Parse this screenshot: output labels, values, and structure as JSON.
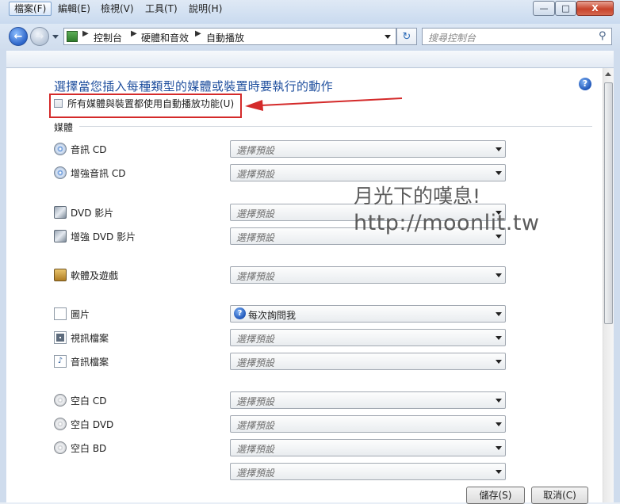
{
  "window": {
    "minimize": "—",
    "maximize": "□",
    "close": "X"
  },
  "nav": {
    "back_icon": "back-arrow-icon",
    "forward_icon": "forward-arrow-icon",
    "breadcrumb": [
      "控制台",
      "硬體和音效",
      "自動播放"
    ],
    "search_placeholder": "搜尋控制台"
  },
  "menu": [
    "檔案(F)",
    "編輯(E)",
    "檢視(V)",
    "工具(T)",
    "說明(H)"
  ],
  "page": {
    "heading": "選擇當您插入每種類型的媒體或裝置時要執行的動作",
    "checkbox_label": "所有媒體與裝置都使用自動播放功能(U)",
    "checkbox_checked": false,
    "section": "媒體"
  },
  "rows": [
    {
      "label": "音訊 CD",
      "icon": "audio-cd-icon",
      "value": "選擇預設"
    },
    {
      "label": "增強音訊 CD",
      "icon": "enhanced-audio-cd-icon",
      "value": "選擇預設"
    },
    {
      "label": "DVD 影片",
      "icon": "dvd-movie-icon",
      "value": "選擇預設"
    },
    {
      "label": "增強 DVD 影片",
      "icon": "enhanced-dvd-icon",
      "value": "選擇預設"
    },
    {
      "label": "軟體及遊戲",
      "icon": "software-games-icon",
      "value": "選擇預設"
    },
    {
      "label": "圖片",
      "icon": "picture-icon",
      "value": "每次詢問我"
    },
    {
      "label": "視訊檔案",
      "icon": "video-file-icon",
      "value": "選擇預設"
    },
    {
      "label": "音訊檔案",
      "icon": "audio-file-icon",
      "value": "選擇預設"
    },
    {
      "label": "空白 CD",
      "icon": "blank-cd-icon",
      "value": "選擇預設"
    },
    {
      "label": "空白 DVD",
      "icon": "blank-dvd-icon",
      "value": "選擇預設"
    },
    {
      "label": "空白 BD",
      "icon": "blank-bd-icon",
      "value": "選擇預設"
    },
    {
      "label": "",
      "icon": "",
      "value": "選擇預設"
    }
  ],
  "watermark": {
    "line1": "月光下的嘆息!",
    "line2": "http://moonlit.tw"
  },
  "buttons": {
    "save": "儲存(S)",
    "cancel": "取消(C)"
  },
  "colors": {
    "heading": "#1f4f9e",
    "annotation": "#d42a2a"
  }
}
